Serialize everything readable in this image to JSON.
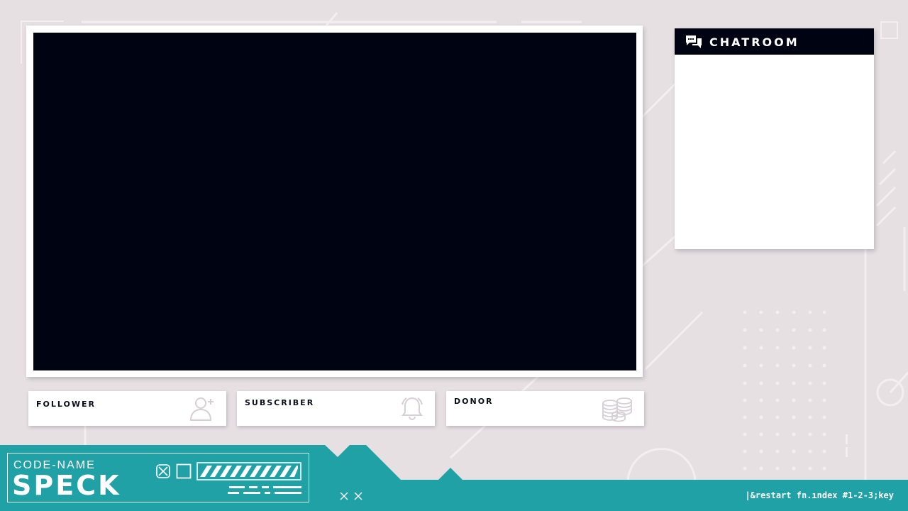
{
  "colors": {
    "background": "#e6e0e3",
    "screen": "#000311",
    "panel": "#ffffff",
    "teal": "#1fa1a6",
    "ink": "#0b0d18"
  },
  "chat": {
    "title": "CHATROOM",
    "icon": "chat-bubbles-icon"
  },
  "stats": [
    {
      "label": "FOLLOWER",
      "icon": "add-user-icon"
    },
    {
      "label": "SUBSCRIBER",
      "icon": "bell-icon"
    },
    {
      "label": "DONOR",
      "icon": "coins-stack-icon"
    }
  ],
  "brand": {
    "subtitle": "CODE-NAME",
    "title": "SPECK"
  },
  "footer": {
    "code": "|&restart fn.ındex #1-2-3;key"
  }
}
